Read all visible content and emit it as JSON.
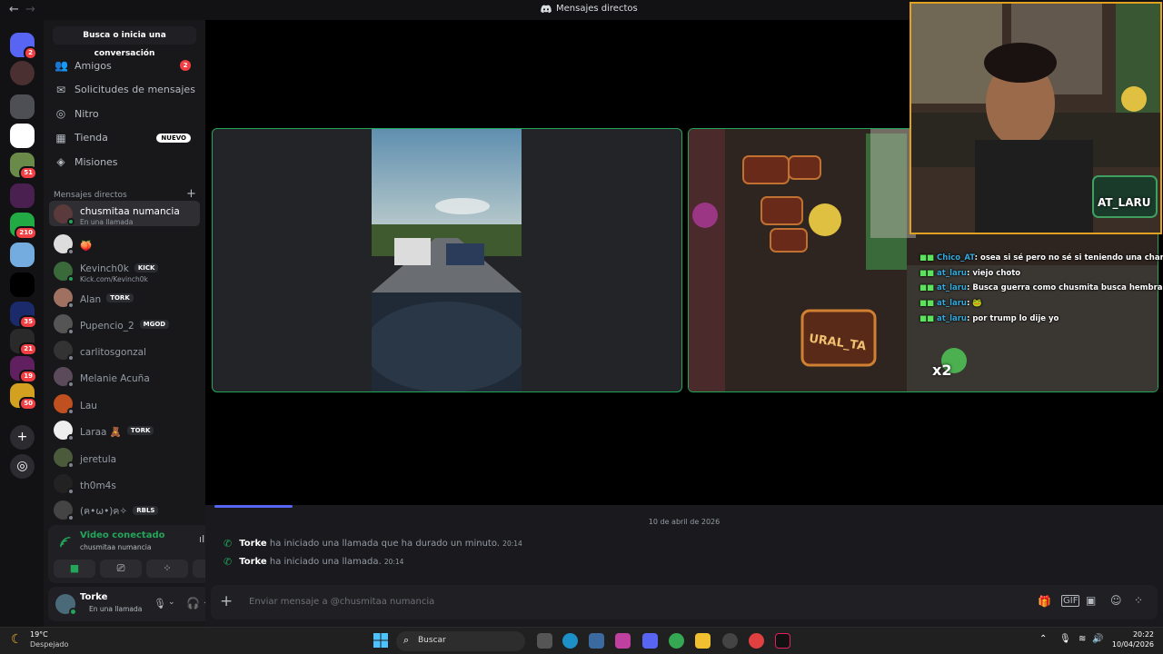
{
  "titlebar": {
    "back": "←",
    "forward": "→",
    "title": "Mensajes directos"
  },
  "servers": [
    {
      "name": "discord-home",
      "color": "#5865f2",
      "badge": "2"
    },
    {
      "name": "avatar",
      "color": "#4a3030",
      "badge": ""
    },
    {
      "name": "server-1",
      "color": "#4e4e55",
      "badge": ""
    },
    {
      "name": "server-2",
      "color": "#ffffff",
      "badge": ""
    },
    {
      "name": "server-3",
      "color": "#6a8a4a",
      "badge": "51"
    },
    {
      "name": "server-4",
      "color": "#4a2050",
      "badge": ""
    },
    {
      "name": "server-5",
      "color": "#22aa44",
      "badge": "210"
    },
    {
      "name": "server-6",
      "color": "#74acdf",
      "badge": ""
    },
    {
      "name": "server-kick",
      "color": "#000000",
      "badge": ""
    },
    {
      "name": "server-7",
      "color": "#1a2a6a",
      "badge": "35"
    },
    {
      "name": "server-8",
      "color": "#2a2a2a",
      "badge": "21"
    },
    {
      "name": "server-9",
      "color": "#602060",
      "badge": "19"
    },
    {
      "name": "server-10",
      "color": "#d4a020",
      "badge": "50"
    }
  ],
  "sidebar": {
    "search": "Busca o inicia una conversación",
    "nav": [
      {
        "label": "Amigos",
        "icon": "👥",
        "count": "2"
      },
      {
        "label": "Solicitudes de mensajes",
        "icon": "✉"
      },
      {
        "label": "Nitro",
        "icon": "◎"
      },
      {
        "label": "Tienda",
        "icon": "▦",
        "tag": "NUEVO"
      },
      {
        "label": "Misiones",
        "icon": "◈"
      }
    ],
    "dm_header": "Mensajes directos",
    "dm_plus": "+",
    "dms": [
      {
        "name": "chusmitaa numancia",
        "sub": "En una llamada",
        "color": "#5a3a3a"
      },
      {
        "name": "🍑",
        "sub": "",
        "color": "#ddd"
      },
      {
        "name": "Kevinch0k",
        "sub": "Kick.com/Kevinch0k",
        "tag": "KICK",
        "color": "#3a6a3a"
      },
      {
        "name": "Alan",
        "sub": "",
        "tag": "TORK",
        "color": "#a07060"
      },
      {
        "name": "Pupencio_2",
        "sub": "",
        "tag": "MGOD",
        "color": "#555"
      },
      {
        "name": "carlitosgonzal",
        "sub": "",
        "color": "#333"
      },
      {
        "name": "Melanie Acuña",
        "sub": "",
        "color": "#5a4a5a"
      },
      {
        "name": "Lau",
        "sub": "",
        "color": "#c05020"
      },
      {
        "name": "Laraa 🧸",
        "sub": "",
        "tag": "TORK",
        "color": "#eee"
      },
      {
        "name": "jeretula",
        "sub": "",
        "color": "#4a5a3a"
      },
      {
        "name": "th0m4s",
        "sub": "",
        "color": "#222"
      },
      {
        "name": "(ฅ•ω•)ฅ✧",
        "sub": "",
        "tag": "RBLS",
        "color": "#444"
      }
    ]
  },
  "voice": {
    "status": "Video conectado",
    "channel": "chusmitaa numancia"
  },
  "user": {
    "name": "Torke",
    "status": "En una llamada"
  },
  "chat": {
    "date": "10 de abril de 2026",
    "messages": [
      {
        "author": "Torke",
        "text": "ha iniciado una llamada que ha durado un minuto.",
        "time": "20:14"
      },
      {
        "author": "Torke",
        "text": "ha iniciado una llamada.",
        "time": "20:14"
      }
    ],
    "placeholder": "Enviar mensaje a @chusmitaa numancia"
  },
  "overlay_chat": [
    {
      "user": "Chico_AT",
      "text": ": osea si sé pero no sé si teniendo una charla"
    },
    {
      "user": "at_laru",
      "text": ": viejo choto"
    },
    {
      "user": "at_laru",
      "text": ": Busca guerra como chusmita busca hembra"
    },
    {
      "user": "at_laru",
      "text": ": 🐸"
    },
    {
      "user": "at_laru",
      "text": ": por trump lo dije yo"
    }
  ],
  "stream_labels": {
    "multiplier": "x2",
    "banner": "AT_LARU",
    "sign": "URAL_TA"
  },
  "taskbar": {
    "temp": "19°C",
    "weather": "Despejado",
    "search": "Buscar",
    "time": "20:22",
    "date": "10/04/2026"
  }
}
